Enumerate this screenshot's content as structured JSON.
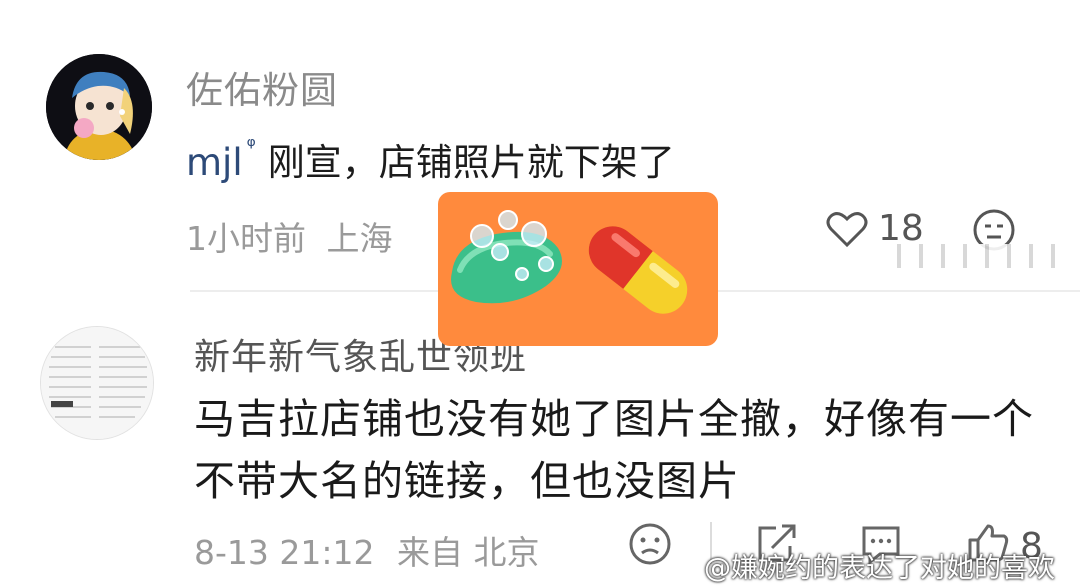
{
  "comment1": {
    "username": "佐佑粉圆",
    "mention": "mjl",
    "text": "刚宣，店铺照片就下架了",
    "time": "1小时前",
    "location": "上海",
    "likes": "18"
  },
  "comment2": {
    "username": "新年新气象乱世领班",
    "text": "马吉拉店铺也没有她了图片全撤，好像有一个不带大名的链接，但也没图片",
    "time": "8-13 21:12",
    "source": "来自 北京",
    "likes": "8"
  },
  "watermark": "@嫌婉约的表达了对她的喜欢",
  "colors": {
    "sticker_bg": "#ff8a3d",
    "mention": "#2d4a78"
  }
}
